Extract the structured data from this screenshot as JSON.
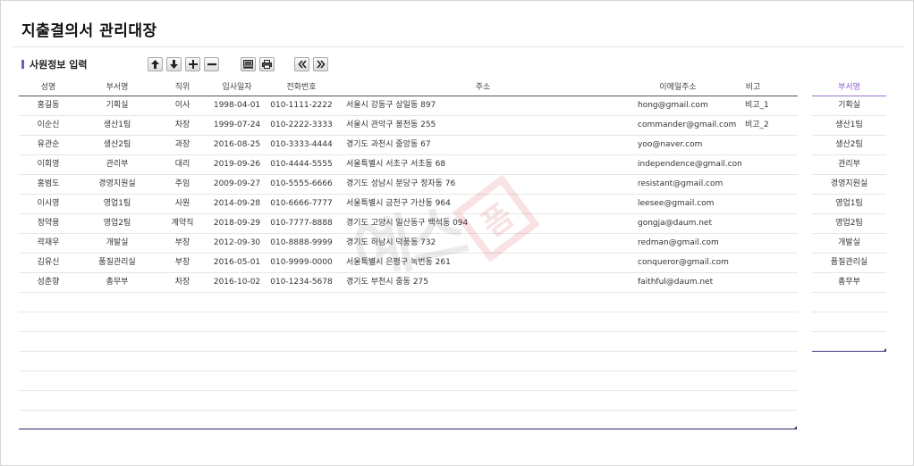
{
  "page": {
    "title": "지출결의서 관리대장"
  },
  "section": {
    "label": "사원정보 입력"
  },
  "toolbar": {
    "buttons": [
      {
        "name": "move-up-button",
        "icon": "arrow-up-icon"
      },
      {
        "name": "move-down-button",
        "icon": "arrow-down-icon"
      },
      {
        "name": "add-row-button",
        "icon": "plus-icon"
      },
      {
        "name": "delete-row-button",
        "icon": "minus-icon"
      },
      {
        "name": "preview-button",
        "icon": "monitor-icon"
      },
      {
        "name": "print-button",
        "icon": "printer-icon"
      },
      {
        "name": "prev-page-button",
        "icon": "double-chevron-left-icon",
        "glyph": "《"
      },
      {
        "name": "next-page-button",
        "icon": "double-chevron-right-icon",
        "glyph": "》"
      }
    ]
  },
  "main_grid": {
    "columns": [
      "성명",
      "부서명",
      "직위",
      "입사일자",
      "전화번호",
      "주소",
      "이메일주소",
      "비고"
    ],
    "rows": [
      [
        "홍길동",
        "기획실",
        "이사",
        "1998-04-01",
        "010-1111-2222",
        "서울시 강동구 상일동 897",
        "hong@gmail.com",
        "비고_1"
      ],
      [
        "이순신",
        "생산1팀",
        "차장",
        "1999-07-24",
        "010-2222-3333",
        "서울시 관악구 봉천동 255",
        "commander@gmail.com",
        "비고_2"
      ],
      [
        "유관순",
        "생산2팀",
        "과장",
        "2016-08-25",
        "010-3333-4444",
        "경기도 과천시 중앙동 67",
        "yoo@naver.com",
        ""
      ],
      [
        "이회영",
        "관리부",
        "대리",
        "2019-09-26",
        "010-4444-5555",
        "서울특별시 서초구 서초동 68",
        "independence@gmail.com",
        ""
      ],
      [
        "홍범도",
        "경영지원실",
        "주임",
        "2009-09-27",
        "010-5555-6666",
        "경기도 성남시 분당구 정자동 76",
        "resistant@gmail.com",
        ""
      ],
      [
        "이시영",
        "영업1팀",
        "사원",
        "2014-09-28",
        "010-6666-7777",
        "서울특별시 금천구 가산동 964",
        "leesee@gmail.com",
        ""
      ],
      [
        "정약용",
        "영업2팀",
        "계약직",
        "2018-09-29",
        "010-7777-8888",
        "경기도 고양시 일산동구 백석동 094",
        "gongja@daum.net",
        ""
      ],
      [
        "곽재우",
        "개발실",
        "부장",
        "2012-09-30",
        "010-8888-9999",
        "경기도 하남시 덕풍동 732",
        "redman@gmail.com",
        ""
      ],
      [
        "김유신",
        "품질관리실",
        "부장",
        "2016-05-01",
        "010-9999-0000",
        "서울특별시 은평구 녹번동 261",
        "conqueror@gmail.com",
        ""
      ],
      [
        "성춘향",
        "총무부",
        "차장",
        "2016-10-02",
        "010-1234-5678",
        "경기도 부천시 중동 275",
        "faithful@daum.net",
        ""
      ]
    ],
    "empty_rows": 7
  },
  "side_grid": {
    "header": "부서명",
    "rows": [
      "기획실",
      "생산1팀",
      "생산2팀",
      "관리부",
      "경영지원실",
      "영업1팀",
      "영업2팀",
      "개발실",
      "품질관리실",
      "총무부"
    ],
    "empty_rows": 3
  },
  "watermark": {
    "text": "예스",
    "stamp": "폼"
  },
  "colors": {
    "accent": "#7a55c7",
    "grid_line": "#3b3b7a",
    "side_header": "#8a5fd0"
  }
}
